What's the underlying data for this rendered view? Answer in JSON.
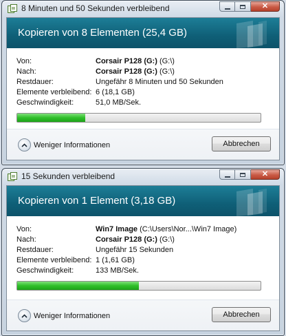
{
  "dialogs": [
    {
      "window_title": "8 Minuten und 50 Sekunden verbleibend",
      "header_title": "Kopieren von 8 Elementen (25,4 GB)",
      "labels": {
        "from": "Von:",
        "to": "Nach:",
        "remaining": "Restdauer:",
        "items_left": "Elemente verbleibend:",
        "speed": "Geschwindigkeit:"
      },
      "from": {
        "name": "Corsair P128 (G:)",
        "detail": "(G:\\)"
      },
      "to": {
        "name": "Corsair P128 (G:)",
        "detail": "(G:\\)"
      },
      "remaining": "Ungefähr 8 Minuten und 50 Sekunden",
      "items_left": "6 (18,1 GB)",
      "speed": "51,0 MB/Sek.",
      "progress_percent": 28,
      "toggle_label": "Weniger Informationen",
      "cancel_label": "Abbrechen"
    },
    {
      "window_title": "15 Sekunden verbleibend",
      "header_title": "Kopieren von 1 Element (3,18 GB)",
      "labels": {
        "from": "Von:",
        "to": "Nach:",
        "remaining": "Restdauer:",
        "items_left": "Elemente verbleibend:",
        "speed": "Geschwindigkeit:"
      },
      "from": {
        "name": "Win7 Image",
        "detail": "(C:\\Users\\Nor...\\Win7 Image)"
      },
      "to": {
        "name": "Corsair P128 (G:)",
        "detail": "(G:\\)"
      },
      "remaining": "Ungefähr 15 Sekunden",
      "items_left": "1 (1,61 GB)",
      "speed": "133 MB/Sek.",
      "progress_percent": 50,
      "toggle_label": "Weniger Informationen",
      "cancel_label": "Abbrechen"
    }
  ],
  "icons": {
    "window": "copy-window-icon",
    "minimize": "minimize-icon",
    "maximize": "maximize-icon",
    "close": "close-icon",
    "toggle": "chevron-up-icon"
  },
  "colors": {
    "header_band": "#0f5f77",
    "progress_fill": "#2fbf2a",
    "close_button": "#c95a45"
  }
}
